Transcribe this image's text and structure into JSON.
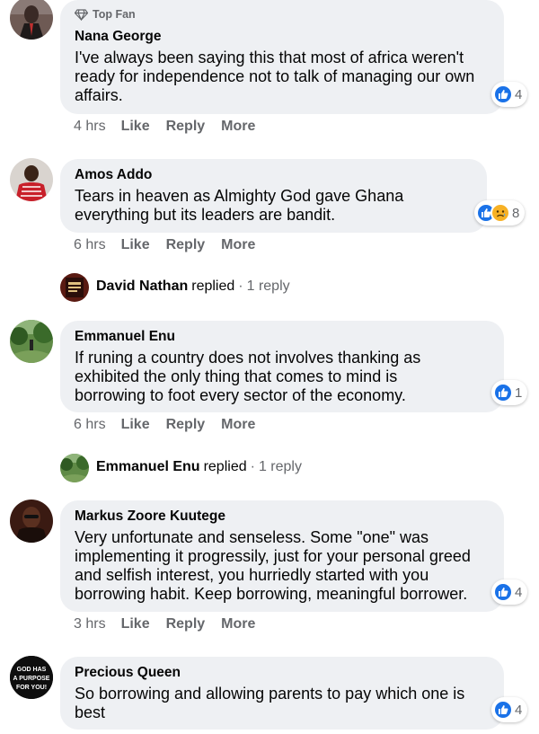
{
  "badge": {
    "top_fan": "Top Fan"
  },
  "actions": {
    "like": "Like",
    "reply": "Reply",
    "more": "More"
  },
  "comments": [
    {
      "author": "Nana George",
      "text": "I've always been saying this that most of africa weren't ready for independence not to talk of managing our own affairs.",
      "time": "4 hrs",
      "reactions": "4",
      "top_fan": true
    },
    {
      "author": "Amos Addo",
      "text": "Tears in heaven as Almighty God gave Ghana everything but its leaders are bandit.",
      "time": "6 hrs",
      "reactions": "8"
    },
    {
      "author": "Emmanuel Enu",
      "text": "If runing a country does not involves thanking as exhibited the only thing that comes to mind is borrowing to foot every sector of the economy.",
      "time": "6 hrs",
      "reactions": "1"
    },
    {
      "author": "Markus Zoore Kuutege",
      "text": "Very unfortunate and senseless. Some \"one\" was implementing it progressily, just for your personal greed and selfish interest, you hurriedly started with you borrowing habit. Keep borrowing, meaningful borrower.",
      "time": "3 hrs",
      "reactions": "4"
    },
    {
      "author": "Precious Queen",
      "text": "So borrowing and allowing parents to pay which one is best",
      "reactions": "4",
      "avatar_text": [
        "GOD HAS",
        "A PURPOSE",
        "FOR YOU!"
      ]
    }
  ],
  "replies": [
    {
      "name": "David Nathan",
      "verb": "replied",
      "sep": "·",
      "count": "1 reply"
    },
    {
      "name": "Emmanuel Enu",
      "verb": "replied",
      "sep": "·",
      "count": "1 reply"
    }
  ],
  "colors": {
    "bubble": "#eef0f3",
    "like_blue": "#1a72e8",
    "sad_yellow": "#f7b125",
    "meta_gray": "#65676b"
  }
}
